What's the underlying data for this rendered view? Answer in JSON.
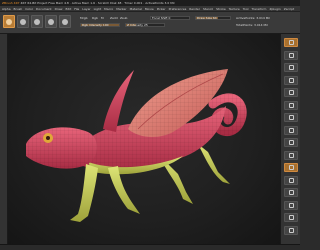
{
  "titlebar": {
    "brand": "ZBrush 4R7",
    "text": "4R7 64-Bit  Project Free Mem 4.8 · Active Mem 1.6 · Scratch Disk 48 · Timer 0.001 · ActivePoints 3.0 Mil"
  },
  "menubar": {
    "items": [
      "Alpha",
      "Brush",
      "Color",
      "Document",
      "Draw",
      "Edit",
      "File",
      "Layer",
      "Light",
      "Macro",
      "Marker",
      "Material",
      "Movie",
      "Picker",
      "Preferences",
      "Render",
      "Stencil",
      "Stroke",
      "Texture",
      "Tool",
      "Transform",
      "Zplugin",
      "Zscript"
    ]
  },
  "topshelf": {
    "tool_buttons": [
      "edit",
      "draw",
      "move",
      "scale",
      "rotate"
    ],
    "labels": {
      "mrgb": "Mrgb",
      "rgb": "Rgb",
      "m": "M",
      "zadd": "Zadd",
      "zsub": "Zsub",
      "focal_shift": "Focal Shift 0",
      "draw_size": "Draw Size 64",
      "rgb_intensity": "Rgb Intensity 100",
      "z_intensity": "Z Intensity 25",
      "active_points": "ActivePoints: 3.014 Mil",
      "total_points": "TotalPoints: 3.014 Mil"
    },
    "draw_size": 64,
    "z_intensity": 25
  },
  "rightshelf": {
    "buttons": [
      "bpr",
      "spix",
      "scroll",
      "zoom",
      "actual",
      "aahalf",
      "persp",
      "floor",
      "local",
      "lsym",
      "frame",
      "move",
      "scale",
      "rotate",
      "polyf",
      "transp"
    ]
  },
  "model": {
    "body_color": "#d9465e",
    "wing_color": "#e58a7a",
    "belly_color": "#c8cf5c",
    "eye_color": "#e0a838"
  }
}
